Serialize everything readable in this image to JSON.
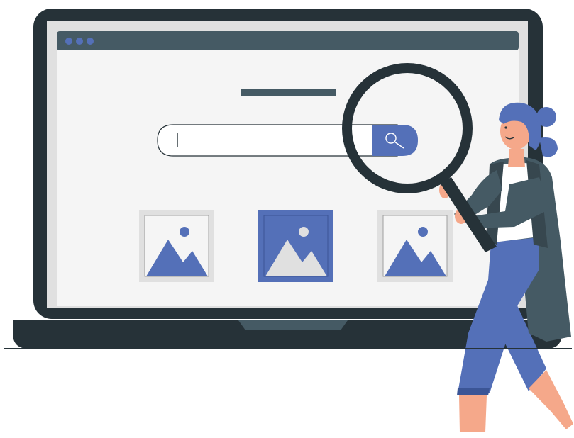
{
  "colors": {
    "laptop_dark": "#263238",
    "screen_frame": "#e0e0e0",
    "screen_bg": "#f5f5f5",
    "browser_bar": "#455a64",
    "accent_blue": "#5470b8",
    "tile_light": "#e0e0e0",
    "skin": "#f5a88a",
    "coat": "#455a64",
    "shirt": "#ffffff"
  },
  "browser": {
    "window_dots": [
      "dot",
      "dot",
      "dot"
    ]
  },
  "search": {
    "value": "",
    "button_icon": "search-icon"
  },
  "image_tiles": [
    {
      "icon": "image-icon",
      "highlighted": false
    },
    {
      "icon": "image-icon",
      "highlighted": true
    },
    {
      "icon": "image-icon",
      "highlighted": false
    }
  ],
  "magnifier": {
    "icon": "magnifying-glass-icon"
  }
}
